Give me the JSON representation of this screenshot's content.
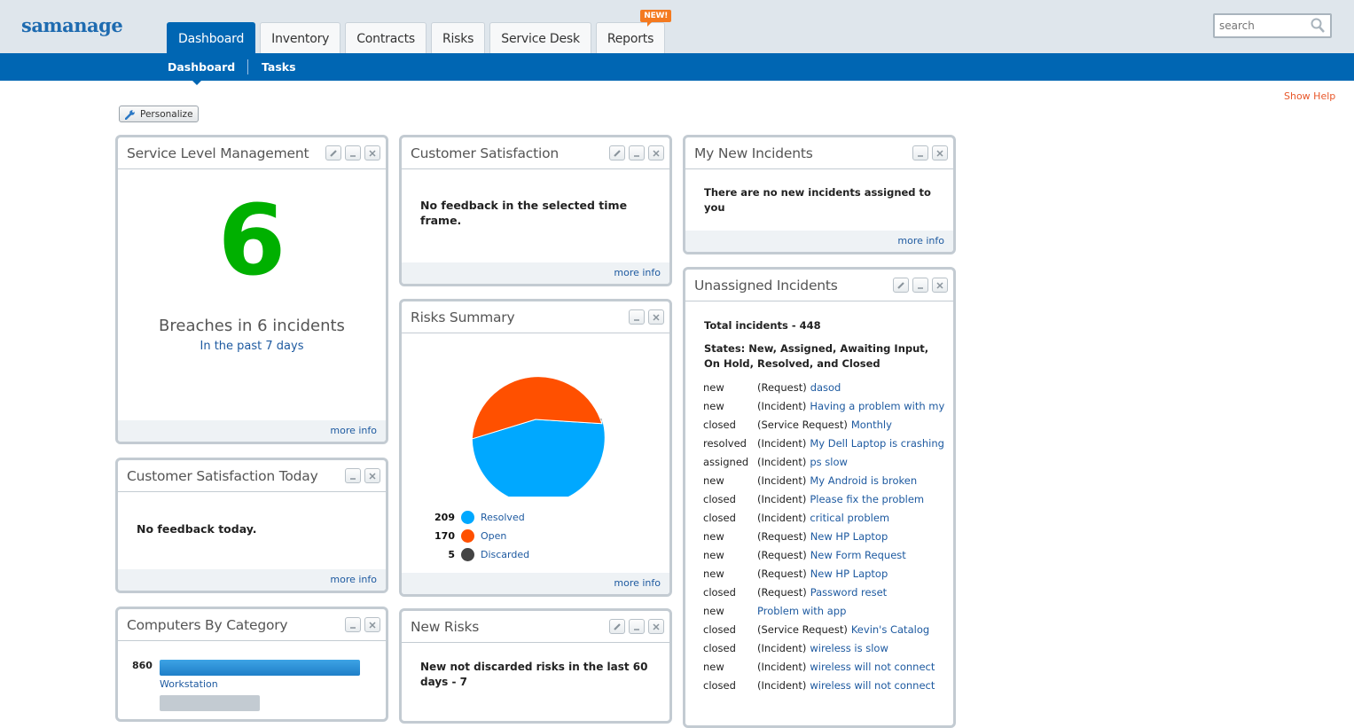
{
  "app": {
    "logo": "samanage"
  },
  "nav": {
    "tabs": [
      {
        "label": "Dashboard",
        "active": true
      },
      {
        "label": "Inventory"
      },
      {
        "label": "Contracts"
      },
      {
        "label": "Risks"
      },
      {
        "label": "Service Desk"
      },
      {
        "label": "Reports",
        "badge": "NEW!"
      }
    ],
    "subnav": [
      {
        "label": "Dashboard",
        "active": true
      },
      {
        "label": "Tasks"
      }
    ],
    "search_placeholder": "search"
  },
  "page": {
    "show_help": "Show Help",
    "personalize": "Personalize",
    "more_info": "more info"
  },
  "widgets": {
    "slm": {
      "title": "Service Level Management",
      "value": "6",
      "label": "Breaches in 6 incidents",
      "sublabel": "In the past 7 days",
      "value_color": "#00b000"
    },
    "csat": {
      "title": "Customer Satisfaction",
      "message": "No feedback in the selected time frame."
    },
    "csat_today": {
      "title": "Customer Satisfaction Today",
      "message": "No feedback today."
    },
    "computers": {
      "title": "Computers By Category",
      "items": [
        {
          "value": "860",
          "label": "Workstation",
          "color": "#2d8fd8"
        },
        {
          "value": "",
          "label": "",
          "color": "#c3cbd2"
        }
      ]
    },
    "risks_summary": {
      "title": "Risks Summary"
    },
    "new_risks": {
      "title": "New Risks",
      "message": "New not discarded risks in the last 60 days - 7"
    },
    "my_new_incidents": {
      "title": "My New Incidents",
      "message": "There are no new incidents assigned to you"
    },
    "unassigned": {
      "title": "Unassigned Incidents",
      "total": "Total incidents - 448",
      "states": "States: New, Assigned, Awaiting Input, On Hold, Resolved, and Closed",
      "rows": [
        {
          "state": "new",
          "type": "(Request)",
          "name": "dasod"
        },
        {
          "state": "new",
          "type": "(Incident)",
          "name": "Having a problem with my"
        },
        {
          "state": "closed",
          "type": "(Service Request)",
          "name": "Monthly"
        },
        {
          "state": "resolved",
          "type": "(Incident)",
          "name": "My Dell Laptop is crashing"
        },
        {
          "state": "assigned",
          "type": "(Incident)",
          "name": "ps slow"
        },
        {
          "state": "new",
          "type": "(Incident)",
          "name": "My Android is broken"
        },
        {
          "state": "closed",
          "type": "(Incident)",
          "name": "Please fix the problem"
        },
        {
          "state": "closed",
          "type": "(Incident)",
          "name": "critical problem"
        },
        {
          "state": "new",
          "type": "(Request)",
          "name": "New HP Laptop"
        },
        {
          "state": "new",
          "type": "(Request)",
          "name": "New Form Request"
        },
        {
          "state": "new",
          "type": "(Request)",
          "name": "New HP Laptop"
        },
        {
          "state": "closed",
          "type": "(Request)",
          "name": "Password reset"
        },
        {
          "state": "new",
          "type": "",
          "name": "Problem with app"
        },
        {
          "state": "closed",
          "type": "(Service Request)",
          "name": "Kevin's Catalog"
        },
        {
          "state": "closed",
          "type": "(Incident)",
          "name": "wireless is slow"
        },
        {
          "state": "new",
          "type": "(Incident)",
          "name": "wireless will not connect"
        },
        {
          "state": "closed",
          "type": "(Incident)",
          "name": "wireless will not connect"
        }
      ]
    }
  },
  "chart_data": {
    "type": "pie",
    "title": "Risks Summary",
    "categories": [
      "Resolved",
      "Open",
      "Discarded"
    ],
    "values": [
      209,
      170,
      5
    ],
    "colors": [
      "#00a8ff",
      "#ff5000",
      "#444444"
    ],
    "legend_position": "bottom-left"
  }
}
